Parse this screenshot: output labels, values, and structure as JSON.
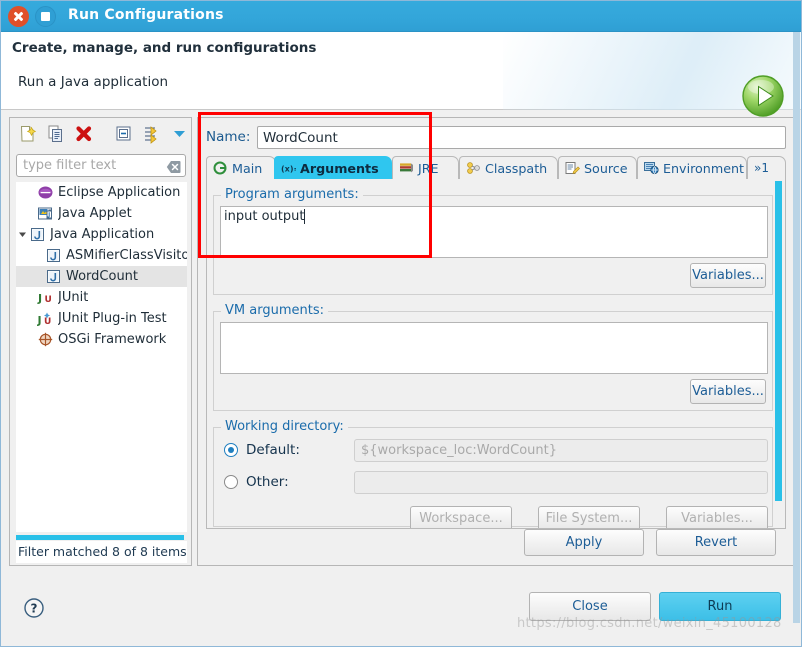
{
  "window": {
    "title": "Run Configurations",
    "close_icon": "close-icon",
    "maximize_icon": "maximize-icon"
  },
  "banner": {
    "title": "Create, manage, and run configurations",
    "subtitle": "Run a Java application",
    "icon": "run-green-play-icon"
  },
  "left_panel": {
    "toolbar": [
      {
        "name": "new-configuration-icon",
        "label": "New launch configuration"
      },
      {
        "name": "duplicate-icon",
        "label": "Duplicate"
      },
      {
        "name": "delete-icon",
        "label": "Delete"
      },
      {
        "name": "collapse-all-icon",
        "label": "Collapse All"
      },
      {
        "name": "filter-icon",
        "label": "Filter launch configurations"
      },
      {
        "name": "view-menu-icon",
        "label": "View Menu"
      }
    ],
    "filter": {
      "placeholder": "type filter text",
      "value": "",
      "clear_icon": "clear-icon"
    },
    "tree": [
      {
        "label": "Eclipse Application",
        "icon": "eclipse-icon",
        "indent": 0,
        "twisty": "",
        "selected": false
      },
      {
        "label": "Java Applet",
        "icon": "java-applet-icon",
        "indent": 0,
        "twisty": "",
        "selected": false
      },
      {
        "label": "Java Application",
        "icon": "java-application-icon",
        "indent": 0,
        "twisty": "expanded",
        "selected": false
      },
      {
        "label": "ASMifierClassVisito",
        "icon": "java-launch-icon",
        "indent": 1,
        "twisty": "",
        "selected": false
      },
      {
        "label": "WordCount",
        "icon": "java-launch-icon",
        "indent": 1,
        "twisty": "",
        "selected": true
      },
      {
        "label": "JUnit",
        "icon": "junit-icon",
        "indent": 0,
        "twisty": "",
        "selected": false
      },
      {
        "label": "JUnit Plug-in Test",
        "icon": "junit-plugin-icon",
        "indent": 0,
        "twisty": "",
        "selected": false
      },
      {
        "label": "OSGi Framework",
        "icon": "osgi-icon",
        "indent": 0,
        "twisty": "",
        "selected": false
      }
    ],
    "status": "Filter matched 8 of 8 items"
  },
  "right_panel": {
    "name_label": "Name:",
    "name_value": "WordCount",
    "tabs": [
      {
        "label": "Main",
        "icon": "main-tab-icon",
        "active": false
      },
      {
        "label": "Arguments",
        "icon": "arguments-tab-icon",
        "active": true
      },
      {
        "label": "JRE",
        "icon": "jre-tab-icon",
        "active": false
      },
      {
        "label": "Classpath",
        "icon": "classpath-tab-icon",
        "active": false
      },
      {
        "label": "Source",
        "icon": "source-tab-icon",
        "active": false
      },
      {
        "label": "Environment",
        "icon": "environment-tab-icon",
        "active": false
      },
      {
        "label": "»1",
        "icon": "tab-overflow-icon",
        "active": false
      }
    ],
    "program_arguments": {
      "title": "Program arguments:",
      "value": "input output",
      "variables_button": "Variables..."
    },
    "vm_arguments": {
      "title": "VM arguments:",
      "value": "",
      "variables_button": "Variables..."
    },
    "working_directory": {
      "title": "Working directory:",
      "default_label": "Default:",
      "default_value": "${workspace_loc:WordCount}",
      "default_selected": true,
      "other_label": "Other:",
      "other_value": "",
      "other_selected": false,
      "buttons": [
        "Workspace...",
        "File System...",
        "Variables..."
      ]
    },
    "apply_label": "Apply",
    "revert_label": "Revert"
  },
  "footer": {
    "help_icon": "help-icon",
    "close_label": "Close",
    "run_label": "Run"
  },
  "watermark": "https://blog.csdn.net/weixin_45100128",
  "colors": {
    "titlebar": "#33a6da",
    "accent": "#2fc6ef",
    "annotation": "#ff0000",
    "link": "#1d5d96",
    "run_button": "#4cc8ec"
  }
}
